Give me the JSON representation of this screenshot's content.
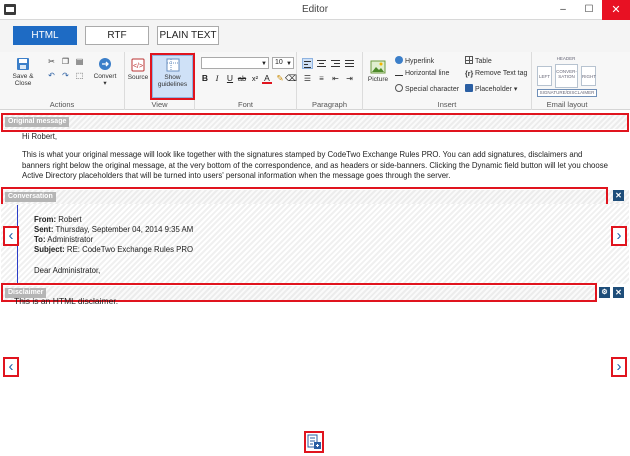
{
  "window": {
    "title": "Editor",
    "minimize": "–",
    "maximize": "☐",
    "close": "✕"
  },
  "modes": [
    {
      "label": "HTML",
      "active": true
    },
    {
      "label": "RTF",
      "active": false
    },
    {
      "label": "PLAIN TEXT",
      "active": false
    }
  ],
  "ribbon": {
    "actions": {
      "label": "Actions",
      "save_close": "Save & Close",
      "convert": "Convert"
    },
    "view": {
      "label": "View",
      "source": "Source",
      "show_guidelines": "Show guidelines"
    },
    "font": {
      "label": "Font",
      "font_size": "10"
    },
    "paragraph": {
      "label": "Paragraph"
    },
    "insert": {
      "label": "Insert",
      "picture": "Picture",
      "hyperlink": "Hyperlink",
      "horizontal_line": "Horizontal line",
      "special_character": "Special character",
      "table": "Table",
      "remove_text_tag": "Remove Text tag",
      "placeholder": "Placeholder"
    },
    "email_layout": {
      "label": "Email layout",
      "header": "HEADER",
      "left": "LEFT",
      "conversation": "CONVER-SATION",
      "right": "RIGHT",
      "signature_disclaimer": "SIGNATURE/DISCLAIMER"
    }
  },
  "sections": {
    "original": "Original message",
    "conversation": "Conversation",
    "disclaimer": "Disclaimer"
  },
  "message": {
    "greeting": "Hi Robert,",
    "body": "This is what your original message will look like together with the signatures stamped by CodeTwo Exchange Rules PRO. You can add signatures, disclaimers and banners right below the original message, at the very bottom of the correspondence, and as headers or side-banners. Clicking the Dynamic field button will let you choose Active Directory placeholders that will be turned into users' personal information when the message goes through the server."
  },
  "conversation": {
    "from_label": "From:",
    "from_value": " Robert",
    "sent_label": "Sent:",
    "sent_value": " Thursday, September 04, 2014 9:35 AM",
    "to_label": "To:",
    "to_value": " Administrator",
    "subject_label": "Subject:",
    "subject_value": " RE: CodeTwo Exchange Rules PRO",
    "salutation": "Dear Administrator,"
  },
  "disclaimer": {
    "text": "This is an HTML disclaimer."
  },
  "arrows": {
    "left": "‹",
    "right": "›"
  },
  "colors": {
    "accent": "#1e6bc4",
    "highlight": "#e0141e",
    "close_button": "#1f4e7a"
  }
}
